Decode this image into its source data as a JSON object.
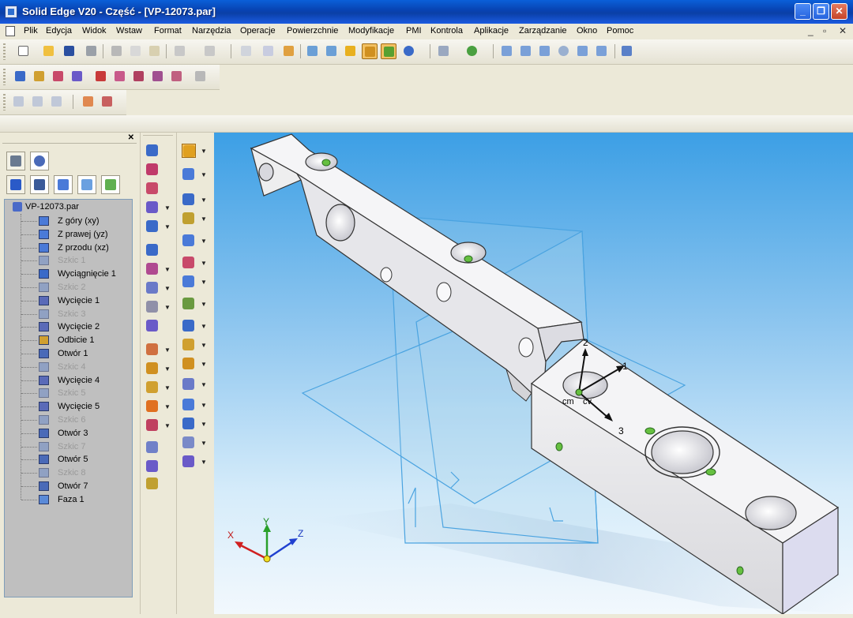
{
  "window": {
    "title": "Solid Edge V20 - Część - [VP-12073.par]"
  },
  "menu": [
    "Plik",
    "Edycja",
    "Widok",
    "Wstaw",
    "Format",
    "Narzędzia",
    "Operacje",
    "Powierzchnie",
    "Modyfikacje",
    "PMI",
    "Kontrola",
    "Aplikacje",
    "Zarządzanie",
    "Okno",
    "Pomoc"
  ],
  "tree": {
    "root": "VP-12073.par",
    "items": [
      {
        "label": "Z góry (xy)",
        "icon": "plane-icon",
        "dim": false
      },
      {
        "label": "Z prawej (yz)",
        "icon": "plane-icon",
        "dim": false
      },
      {
        "label": "Z przodu (xz)",
        "icon": "plane-icon",
        "dim": false
      },
      {
        "label": "Szkic 1",
        "icon": "sketch-icon",
        "dim": true
      },
      {
        "label": "Wyciągnięcie 1",
        "icon": "protrusion-icon",
        "dim": false
      },
      {
        "label": "Szkic 2",
        "icon": "sketch-icon",
        "dim": true
      },
      {
        "label": "Wycięcie 1",
        "icon": "cutout-icon",
        "dim": false
      },
      {
        "label": "Szkic 3",
        "icon": "sketch-icon",
        "dim": true
      },
      {
        "label": "Wycięcie 2",
        "icon": "cutout-icon",
        "dim": false
      },
      {
        "label": "Odbicie 1",
        "icon": "mirror-icon",
        "dim": false
      },
      {
        "label": "Otwór 1",
        "icon": "hole-icon",
        "dim": false
      },
      {
        "label": "Szkic 4",
        "icon": "sketch-icon",
        "dim": true
      },
      {
        "label": "Wycięcie 4",
        "icon": "cutout-icon",
        "dim": false
      },
      {
        "label": "Szkic 5",
        "icon": "sketch-icon",
        "dim": true
      },
      {
        "label": "Wycięcie 5",
        "icon": "cutout-icon",
        "dim": false
      },
      {
        "label": "Szkic 6",
        "icon": "sketch-icon",
        "dim": true
      },
      {
        "label": "Otwór 3",
        "icon": "hole-icon",
        "dim": false
      },
      {
        "label": "Szkic 7",
        "icon": "sketch-icon",
        "dim": true
      },
      {
        "label": "Otwór 5",
        "icon": "hole-icon",
        "dim": false
      },
      {
        "label": "Szkic 8",
        "icon": "sketch-icon",
        "dim": true
      },
      {
        "label": "Otwór 7",
        "icon": "hole-icon",
        "dim": false
      },
      {
        "label": "Faza 1",
        "icon": "chamfer-icon",
        "dim": false
      }
    ]
  },
  "viewport": {
    "triad_labels": {
      "one": "1",
      "two": "2",
      "three": "3",
      "cm": "cm",
      "cv": "cv"
    },
    "axes": {
      "x": "X",
      "y": "Y",
      "z": "Z"
    }
  },
  "colors": {
    "title_bar": "#0a3fa6",
    "part_face": "#f2f2f4",
    "hole_marker": "#66c040",
    "plane_outline": "#4aa3e0",
    "selected_tool": "#f2c062"
  }
}
